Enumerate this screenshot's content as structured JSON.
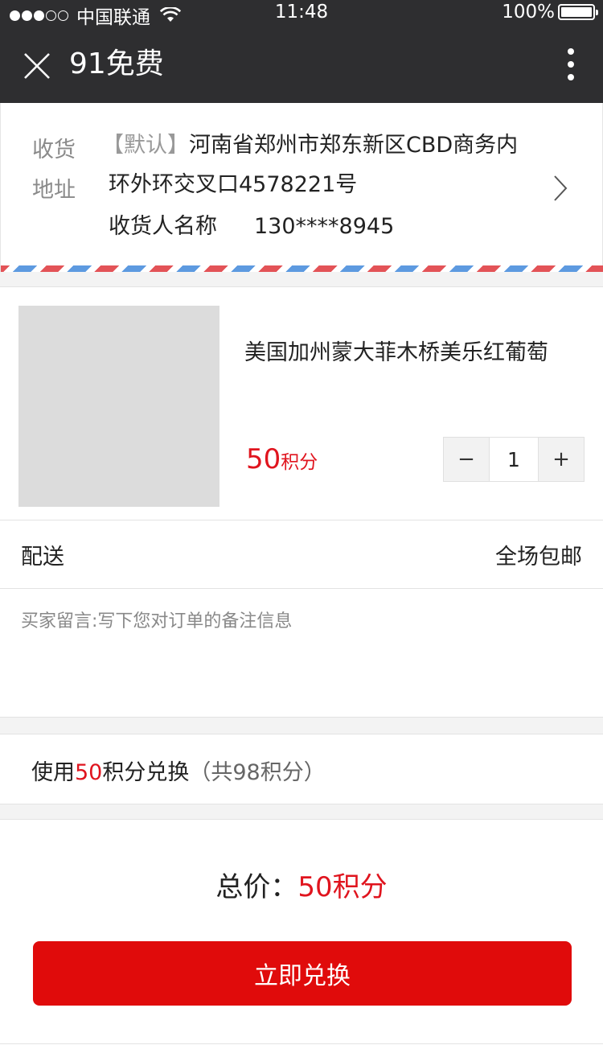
{
  "status_bar": {
    "carrier": "中国联通",
    "time": "11:48",
    "battery": "100%",
    "signal_level": 3
  },
  "nav": {
    "title": "91免费",
    "close_icon": "close-icon",
    "more_icon": "more-vertical-icon"
  },
  "address": {
    "label_line1": "收货",
    "label_line2": "地址",
    "tag": "【默认】",
    "detail": "河南省郑州市郑东新区CBD商务内环外环交叉口4578221号",
    "recipient": "收货人名称",
    "phone": "130****8945",
    "arrow_icon": "chevron-right-icon"
  },
  "product": {
    "name": "美国加州蒙大菲木桥美乐红葡萄",
    "price": "50",
    "price_unit": "积分",
    "quantity": "1",
    "minus_label": "−",
    "plus_label": "+"
  },
  "delivery": {
    "label": "配送",
    "value": "全场包邮"
  },
  "message": {
    "placeholder": "买家留言:写下您对订单的备注信息",
    "value": ""
  },
  "points": {
    "prefix": "使用",
    "amount": "50",
    "suffix": "积分兑换",
    "total_note": "（共98积分）"
  },
  "footer": {
    "total_label": "总价：",
    "total_value": "50积分",
    "submit_label": "立即兑换"
  },
  "colors": {
    "accent": "#e0141e",
    "navbar": "#2e2e30",
    "button": "#e00b0b"
  }
}
